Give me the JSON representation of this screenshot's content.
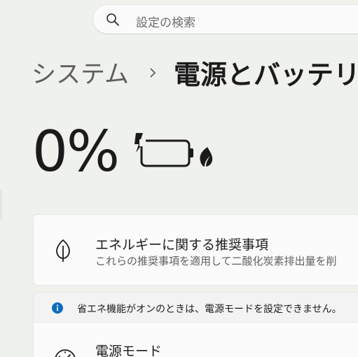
{
  "search": {
    "placeholder": "設定の検索",
    "icon": "search-icon"
  },
  "breadcrumb": {
    "parent": "システム",
    "separator_icon": "chevron-right-icon",
    "current": "電源とバッテリー"
  },
  "battery": {
    "percent_text": "0%",
    "level_percent": 0,
    "charging": true,
    "icon": "battery-charging-icon",
    "saver_icon": "leaf-icon"
  },
  "recommendations": {
    "icon": "leaf-outline-icon",
    "title": "エネルギーに関する推奨事項",
    "description": "これらの推奨事項を適用して二酸化炭素排出量を削"
  },
  "info": {
    "icon": "info-icon",
    "text": "省エネ機能がオンのときは、電源モードを設定できません。",
    "accent": "#0f6cbd"
  },
  "power_mode": {
    "icon": "speedometer-icon",
    "title": "電源モード"
  }
}
